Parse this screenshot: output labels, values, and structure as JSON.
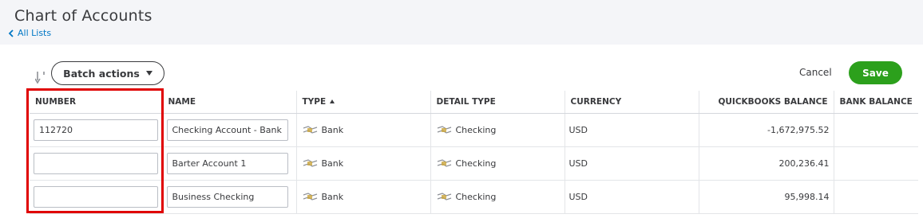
{
  "header": {
    "title": "Chart of Accounts",
    "back_link": "All Lists"
  },
  "toolbar": {
    "batch_actions_label": "Batch actions",
    "cancel_label": "Cancel",
    "save_label": "Save"
  },
  "table": {
    "columns": [
      "NUMBER",
      "NAME",
      "TYPE",
      "DETAIL TYPE",
      "CURRENCY",
      "QUICKBOOKS BALANCE",
      "BANK BALANCE"
    ],
    "sorted_column": "TYPE",
    "sort_direction": "ascending",
    "rows": [
      {
        "number": "112720",
        "name": "Checking Account - Bank of",
        "type": "Bank",
        "detail_type": "Checking",
        "currency": "USD",
        "qb_balance": "-1,672,975.52",
        "bank_balance": ""
      },
      {
        "number": "",
        "name": "Barter Account 1",
        "type": "Bank",
        "detail_type": "Checking",
        "currency": "USD",
        "qb_balance": "200,236.41",
        "bank_balance": ""
      },
      {
        "number": "",
        "name": "Business Checking",
        "type": "Bank",
        "detail_type": "Checking",
        "currency": "USD",
        "qb_balance": "95,998.14",
        "bank_balance": ""
      }
    ]
  },
  "icons": {
    "back": "chevron-left-icon",
    "batch_caret": "caret-down-icon",
    "type_row": "bank-icon",
    "detail_row": "bank-icon"
  },
  "colors": {
    "accent_link": "#0077c5",
    "save_button": "#2ca01c",
    "highlight_border": "#e00000",
    "header_bg": "#f4f5f8"
  }
}
